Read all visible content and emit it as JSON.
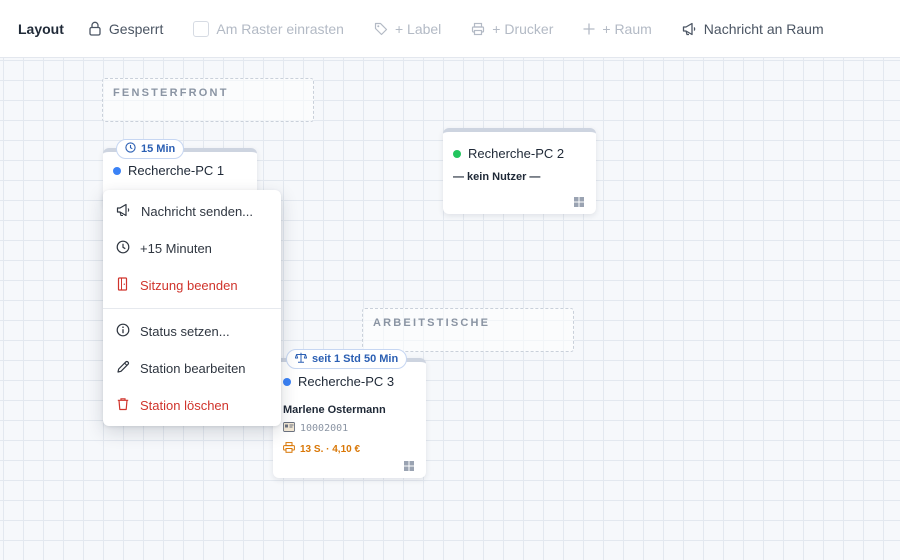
{
  "toolbar": {
    "title": "Layout",
    "lock_label": "Gesperrt",
    "snap_label": "Am Raster einrasten",
    "label_label": "+ Label",
    "printer_label": "+ Drucker",
    "room_label": "+ Raum",
    "message_label": "Nachricht an Raum"
  },
  "zones": {
    "fensterfront": "FENSTERFRONT",
    "arbeitstische": "ARBEITSTISCHE"
  },
  "stations": {
    "pc1": {
      "name": "Recherche-PC 1",
      "badge": "15 Min",
      "status_color": "#3b82f6"
    },
    "pc2": {
      "name": "Recherche-PC 2",
      "user": "— kein Nutzer —",
      "status_color": "#22c55e"
    },
    "pc3": {
      "name": "Recherche-PC 3",
      "badge": "seit 1 Std 50 Min",
      "user": "Marlene Ostermann",
      "card_id": "10002001",
      "print_info": "13 S. · 4,10 €",
      "status_color": "#3b82f6"
    }
  },
  "context_menu": {
    "send_message": "Nachricht senden...",
    "add_minutes": "+15 Minuten",
    "end_session": "Sitzung beenden",
    "set_status": "Status setzen...",
    "edit_station": "Station bearbeiten",
    "delete_station": "Station löschen"
  },
  "colors": {
    "accent": "#2b5fb3",
    "danger": "#d0342c",
    "print": "#d97706",
    "available": "#22c55e",
    "in_use": "#3b82f6"
  }
}
